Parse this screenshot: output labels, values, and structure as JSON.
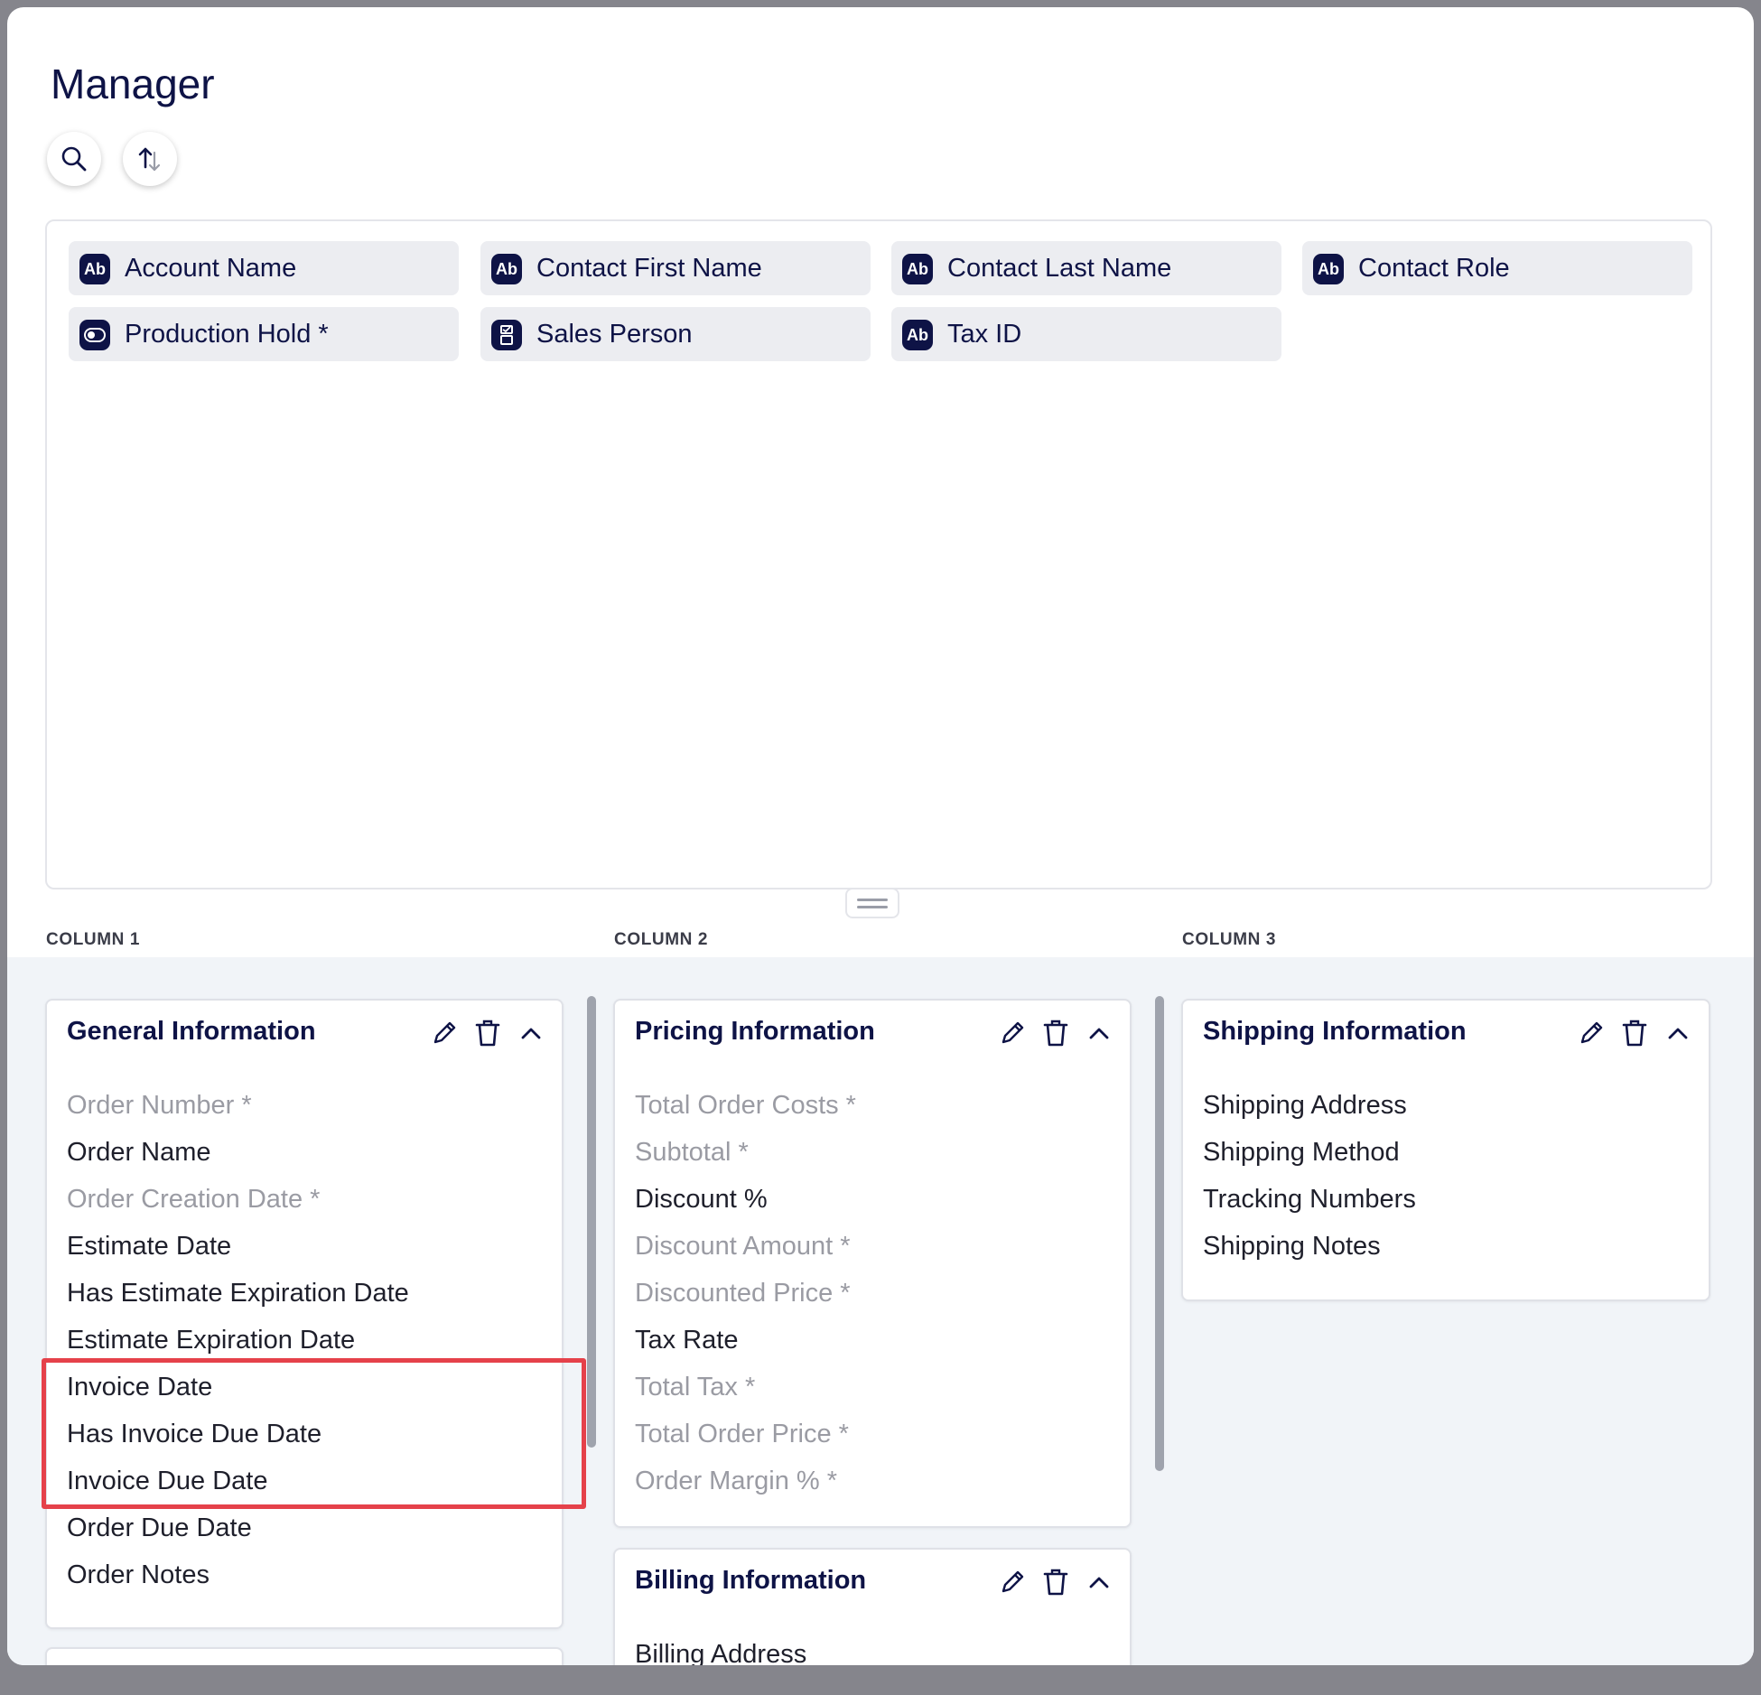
{
  "page": {
    "title": "Manager",
    "search_icon": "search-icon",
    "sort_icon": "sort-icon"
  },
  "available_fields": [
    {
      "label": "Account Name",
      "icon": "text-field-icon",
      "icon_text": "Ab"
    },
    {
      "label": "Contact First Name",
      "icon": "text-field-icon",
      "icon_text": "Ab"
    },
    {
      "label": "Contact Last Name",
      "icon": "text-field-icon",
      "icon_text": "Ab"
    },
    {
      "label": "Contact Role",
      "icon": "text-field-icon",
      "icon_text": "Ab"
    },
    {
      "label": "Production Hold *",
      "icon": "toggle-field-icon",
      "icon_text": ""
    },
    {
      "label": "Sales Person",
      "icon": "user-select-field-icon",
      "icon_text": ""
    },
    {
      "label": "Tax ID",
      "icon": "text-field-icon",
      "icon_text": "Ab"
    }
  ],
  "columns": [
    {
      "label": "COLUMN 1"
    },
    {
      "label": "COLUMN 2"
    },
    {
      "label": "COLUMN 3"
    }
  ],
  "sections": {
    "general": {
      "title": "General Information",
      "fields": [
        {
          "label": "Order Number *",
          "readonly": true
        },
        {
          "label": "Order Name",
          "readonly": false
        },
        {
          "label": "Order Creation Date *",
          "readonly": true
        },
        {
          "label": "Estimate Date",
          "readonly": false
        },
        {
          "label": "Has Estimate Expiration Date",
          "readonly": false
        },
        {
          "label": "Estimate Expiration Date",
          "readonly": false
        },
        {
          "label": "Invoice Date",
          "readonly": false
        },
        {
          "label": "Has Invoice Due Date",
          "readonly": false
        },
        {
          "label": "Invoice Due Date",
          "readonly": false
        },
        {
          "label": "Order Due Date",
          "readonly": false
        },
        {
          "label": "Order Notes",
          "readonly": false
        }
      ]
    },
    "pricing": {
      "title": "Pricing Information",
      "fields": [
        {
          "label": "Total Order Costs *",
          "readonly": true
        },
        {
          "label": "Subtotal *",
          "readonly": true
        },
        {
          "label": "Discount %",
          "readonly": false
        },
        {
          "label": "Discount Amount *",
          "readonly": true
        },
        {
          "label": "Discounted Price *",
          "readonly": true
        },
        {
          "label": "Tax Rate",
          "readonly": false
        },
        {
          "label": "Total Tax *",
          "readonly": true
        },
        {
          "label": "Total Order Price *",
          "readonly": true
        },
        {
          "label": "Order Margin % *",
          "readonly": true
        }
      ]
    },
    "billing": {
      "title": "Billing Information",
      "fields": [
        {
          "label": "Billing Address",
          "readonly": false
        }
      ]
    },
    "shipping": {
      "title": "Shipping Information",
      "fields": [
        {
          "label": "Shipping Address",
          "readonly": false
        },
        {
          "label": "Shipping Method",
          "readonly": false
        },
        {
          "label": "Tracking Numbers",
          "readonly": false
        },
        {
          "label": "Shipping Notes",
          "readonly": false
        }
      ]
    }
  },
  "colors": {
    "accent": "#0e1346",
    "readonly_text": "#9a9ba3",
    "highlight": "#e5414a"
  }
}
